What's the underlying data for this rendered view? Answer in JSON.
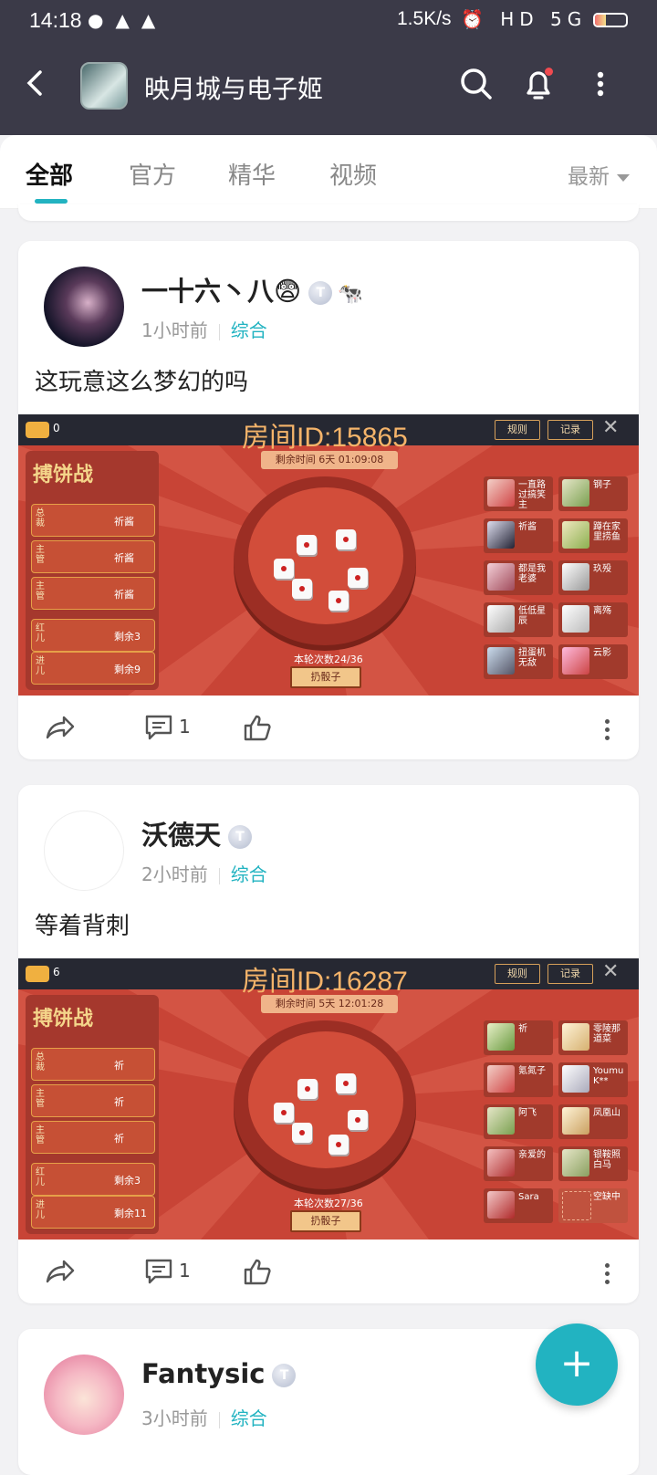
{
  "status_bar": {
    "time": "14:18",
    "net_speed": "1.5K/s",
    "notif_icons": [
      "wechat-icon",
      "qq-icon",
      "qq-icon"
    ],
    "right_icons": "⏰ HD 5G",
    "battery_level": 0.35
  },
  "header": {
    "title": "映月城与电子姬"
  },
  "tabs": [
    {
      "label": "全部"
    },
    {
      "label": "官方"
    },
    {
      "label": "精华"
    },
    {
      "label": "视频"
    }
  ],
  "sort": {
    "label": "最新"
  },
  "posts": [
    {
      "username": "一十六丶八😨",
      "badge": "T",
      "time": "1小时前",
      "category": "综合",
      "text": "这玩意这么梦幻的吗",
      "game": {
        "room_id": "房间ID:15865",
        "coin": "0",
        "rules": "规则",
        "record": "记录",
        "panel_title": "搏饼战",
        "timer": "剩余时间  6天 01:09:08",
        "rows": [
          {
            "label": "总裁",
            "text": "祈酱"
          },
          {
            "label": "主管",
            "text": "祈酱"
          },
          {
            "label": "主管",
            "text": "祈酱"
          },
          {
            "label": "红儿",
            "text": "剩余3"
          },
          {
            "label": "进儿",
            "text": "剩余9"
          }
        ],
        "round": "本轮次数24/36",
        "roll": "扔骰子",
        "players": [
          "一直路过搞笑主",
          "钢子",
          "祈酱",
          "蹲在家里捞鱼",
          "都是我老婆",
          "玖殁",
          "低低星辰",
          "离殇",
          "扭蛋机无敌",
          "云影"
        ]
      },
      "comments": "1"
    },
    {
      "username": "沃德天",
      "badge": "T",
      "time": "2小时前",
      "category": "综合",
      "text": "等着背刺",
      "game": {
        "room_id": "房间ID:16287",
        "coin": "6",
        "rules": "规则",
        "record": "记录",
        "panel_title": "搏饼战",
        "timer": "剩余时间  5天 12:01:28",
        "rows": [
          {
            "label": "总裁",
            "text": "祈"
          },
          {
            "label": "主管",
            "text": "祈"
          },
          {
            "label": "主管",
            "text": "祈"
          },
          {
            "label": "红儿",
            "text": "剩余3"
          },
          {
            "label": "进儿",
            "text": "剩余11"
          }
        ],
        "round": "本轮次数27/36",
        "roll": "扔骰子",
        "players": [
          "祈",
          "零陵那道菜",
          "氪氮子",
          "Youmu K**",
          "阿飞",
          "凤凰山",
          "亲爱的",
          "银鞍照白马",
          "Sara",
          "空缺中"
        ]
      },
      "comments": "1"
    },
    {
      "username": "Fantysic",
      "badge": "T",
      "time": "3小时前",
      "category": "综合"
    }
  ],
  "fab": {
    "label": "+"
  }
}
